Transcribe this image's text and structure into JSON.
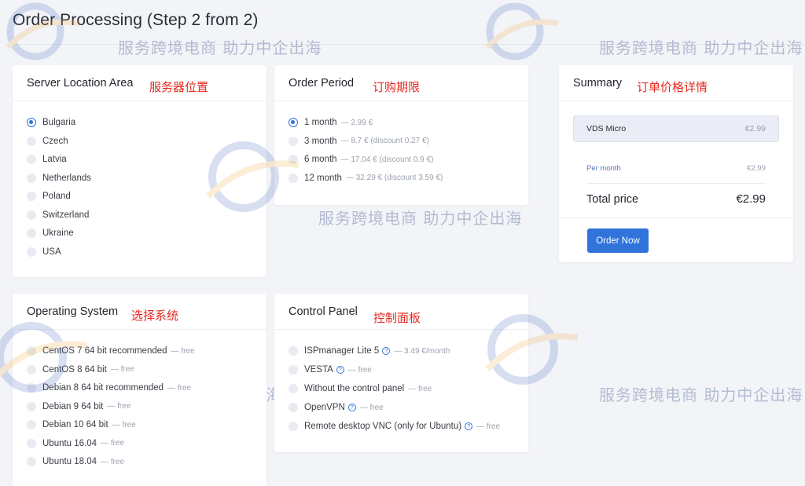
{
  "page": {
    "title": "Order Processing (Step 2 from 2)"
  },
  "watermark": {
    "tagline": "服务跨境电商 助力中企出海"
  },
  "location": {
    "title": "Server Location Area",
    "note_zh": "服务器位置",
    "options": [
      "Bulgaria",
      "Czech",
      "Latvia",
      "Netherlands",
      "Poland",
      "Switzerland",
      "Ukraine",
      "USA"
    ],
    "selected": "Bulgaria"
  },
  "period": {
    "title": "Order Period",
    "note_zh": "订购期限",
    "options": [
      {
        "label": "1 month",
        "price": "— 2.99 €"
      },
      {
        "label": "3 month",
        "price": "— 8.7 € (discount 0.27 €)"
      },
      {
        "label": "6 month",
        "price": "— 17.04 € (discount 0.9 €)"
      },
      {
        "label": "12 month",
        "price": "— 32.29 € (discount 3.59 €)"
      }
    ],
    "selected": "1 month"
  },
  "summary": {
    "title": "Summary",
    "note_zh": "订单价格详情",
    "plan_name": "VDS Micro",
    "plan_price": "€2.99",
    "per_month_label": "Per month",
    "per_month_value": "€2.99",
    "total_label": "Total price",
    "total_value": "€2.99",
    "order_button": "Order Now"
  },
  "os": {
    "title": "Operating System",
    "note_zh": "选择系统",
    "options": [
      {
        "label": "CentOS 7 64 bit recommended",
        "price": "— free"
      },
      {
        "label": "CentOS 8 64 bit",
        "price": "— free"
      },
      {
        "label": "Debian 8 64 bit recommended",
        "price": "— free"
      },
      {
        "label": "Debian 9 64 bit",
        "price": "— free"
      },
      {
        "label": "Debian 10 64 bit",
        "price": "— free"
      },
      {
        "label": "Ubuntu 16.04",
        "price": "— free"
      },
      {
        "label": "Ubuntu 18.04",
        "price": "— free"
      }
    ]
  },
  "panel": {
    "title": "Control Panel",
    "note_zh": "控制面板",
    "options": [
      {
        "label": "ISPmanager Lite 5",
        "help": true,
        "price": "— 3.49 €/month"
      },
      {
        "label": "VESTA",
        "help": true,
        "price": "— free"
      },
      {
        "label": "Without the control panel",
        "help": false,
        "price": "— free"
      },
      {
        "label": "OpenVPN",
        "help": true,
        "price": "— free"
      },
      {
        "label": "Remote desktop VNC (only for Ubuntu)",
        "help": true,
        "price": "— free"
      }
    ],
    "help_icon_glyph": "?"
  },
  "colors": {
    "accent": "#2f73db",
    "annotation": "#e8281e",
    "background": "#f3f4f8"
  }
}
